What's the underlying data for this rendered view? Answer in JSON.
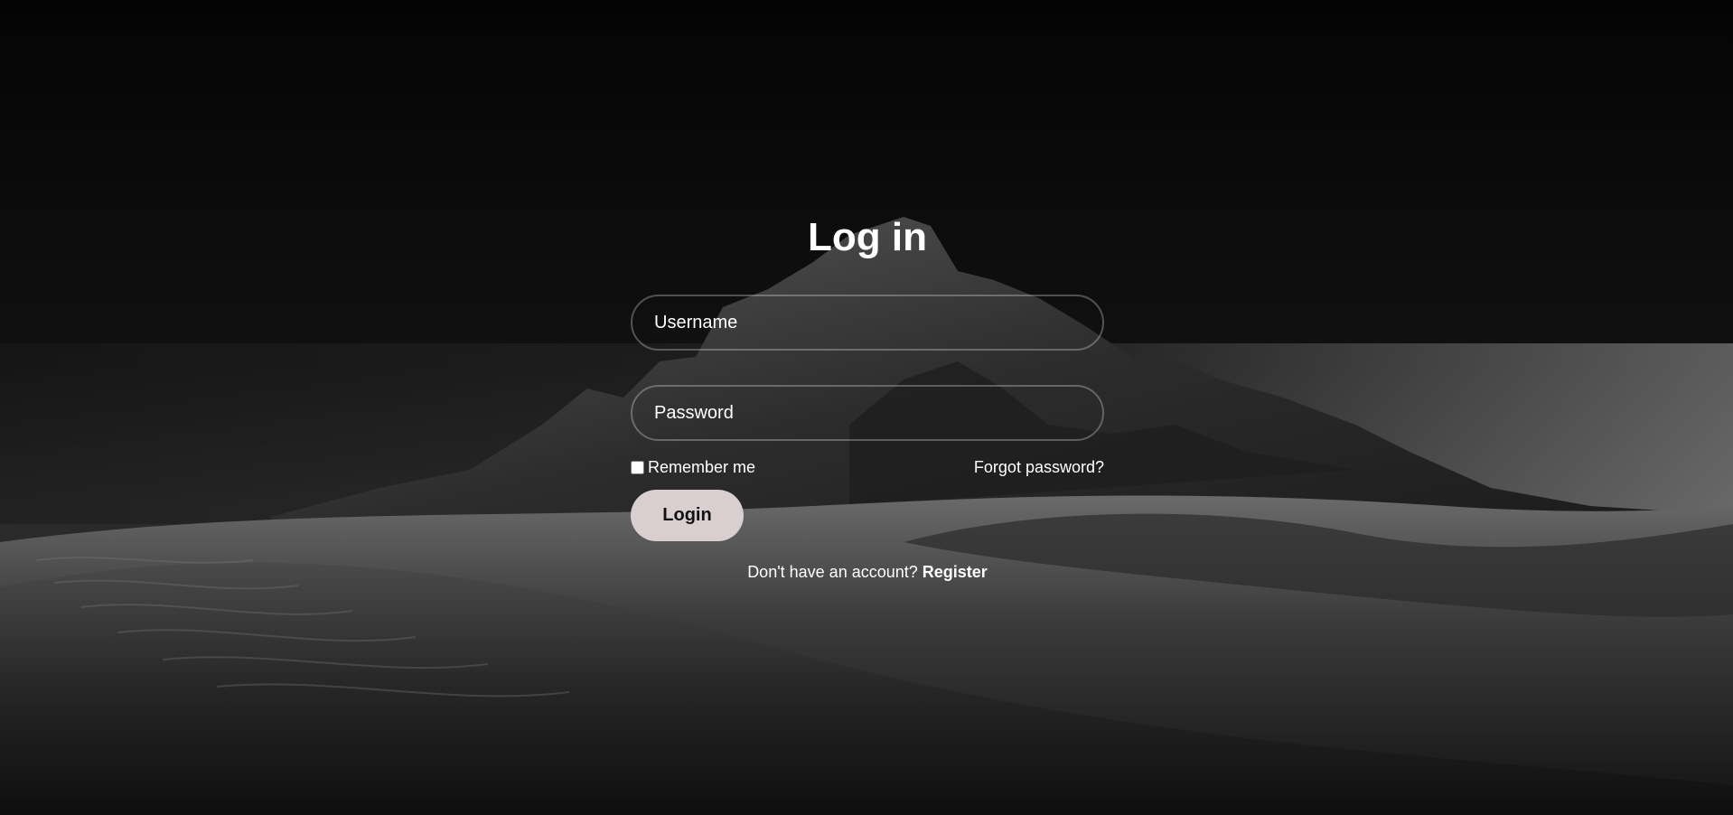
{
  "login": {
    "title": "Log in",
    "username_placeholder": "Username",
    "password_placeholder": "Password",
    "remember_label": "Remember me",
    "forgot_label": "Forgot password?",
    "button_label": "Login",
    "no_account_text": "Don't have an account?",
    "register_label": "Register"
  },
  "background": {
    "subject": "desert mountain landscape at night (grayscale)"
  },
  "colors": {
    "button_background": "#d9cfd0",
    "text": "#ffffff",
    "field_border": "rgba(255,255,255,0.28)"
  }
}
